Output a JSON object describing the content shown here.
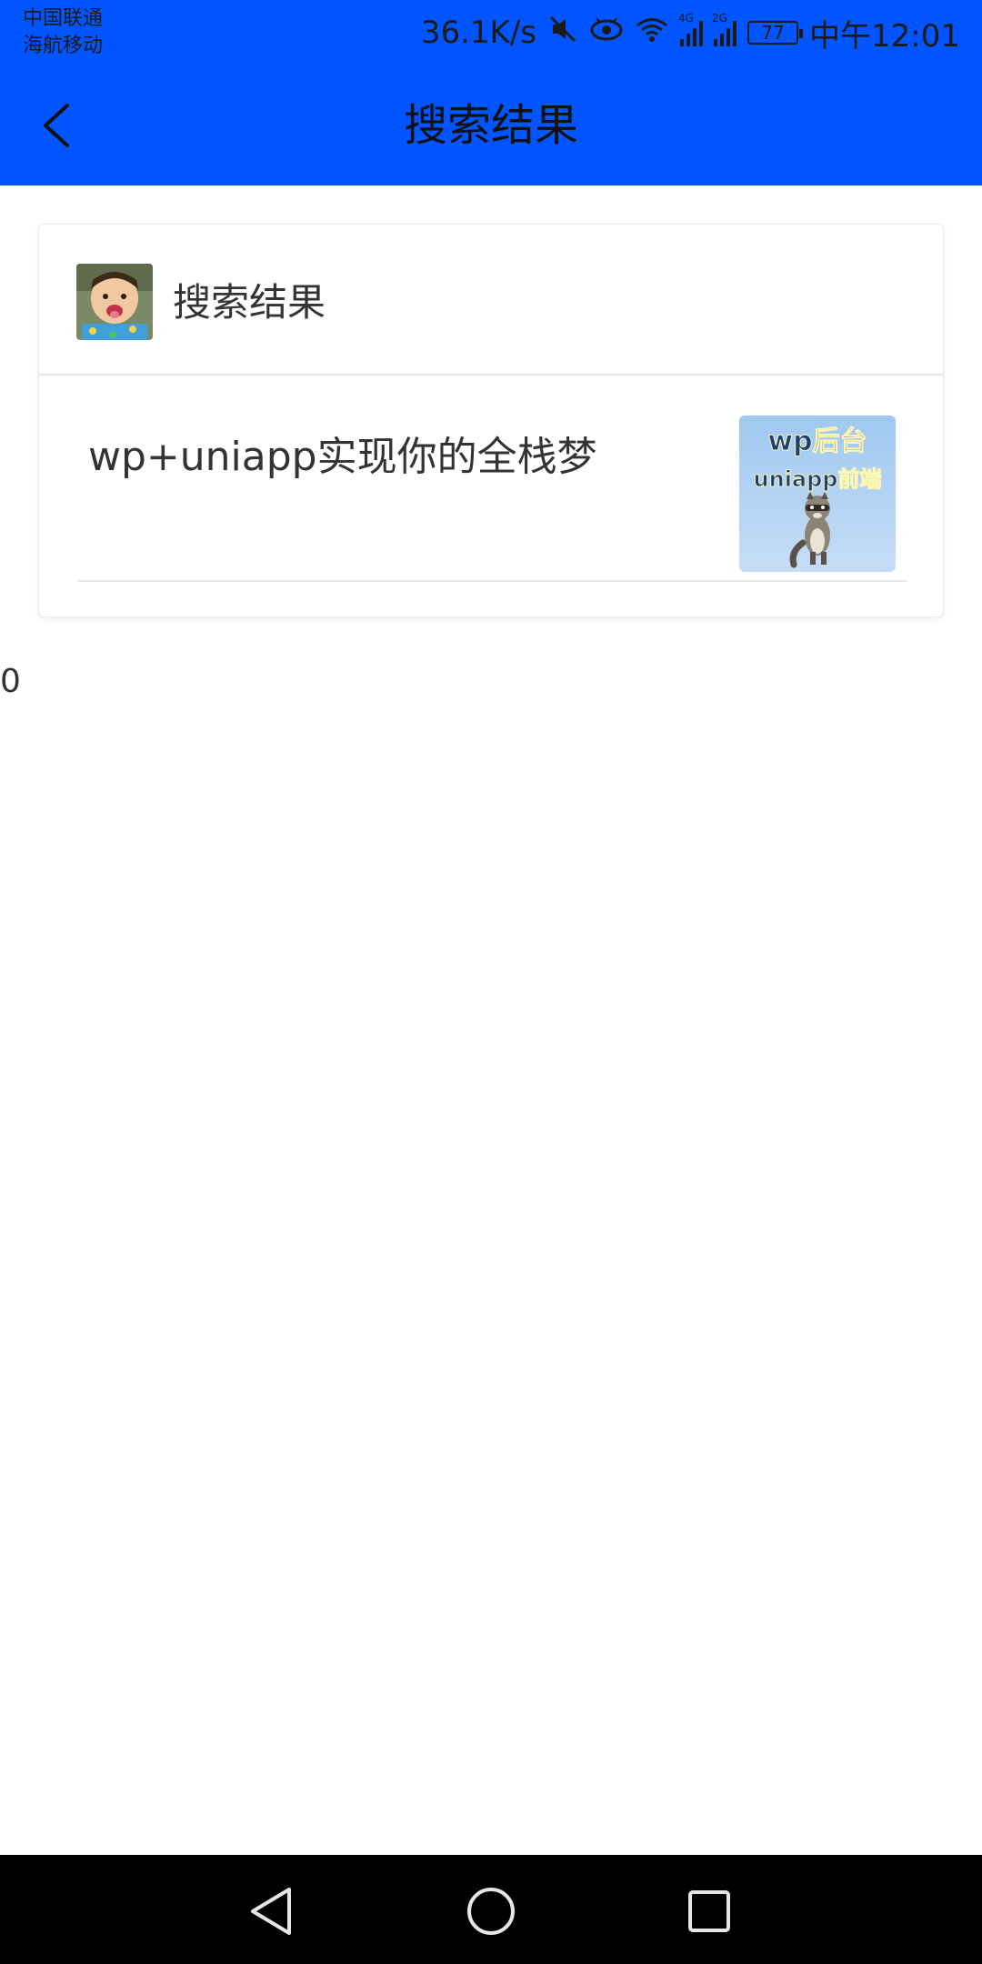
{
  "status_bar": {
    "carrier_line1": "中国联通",
    "carrier_line2": "海航移动",
    "net_speed": "36.1K/s",
    "signal1_tag": "4G",
    "signal2_tag": "2G",
    "battery": "77",
    "time": "中午12:01"
  },
  "header": {
    "title": "搜索结果",
    "back_icon": "chevron-left-icon",
    "background": "#0055fe"
  },
  "card": {
    "title": "搜索结果",
    "avatar": "child-avatar",
    "articles": [
      {
        "title": "wp+uniapp实现你的全栈梦",
        "thumbnail_text_line1": "wp后台",
        "thumbnail_text_line2": "uniapp前端"
      }
    ]
  },
  "count_text": "0",
  "nav_bar": {
    "back_icon": "triangle-back-icon",
    "home_icon": "circle-home-icon",
    "recent_icon": "square-recent-icon"
  }
}
